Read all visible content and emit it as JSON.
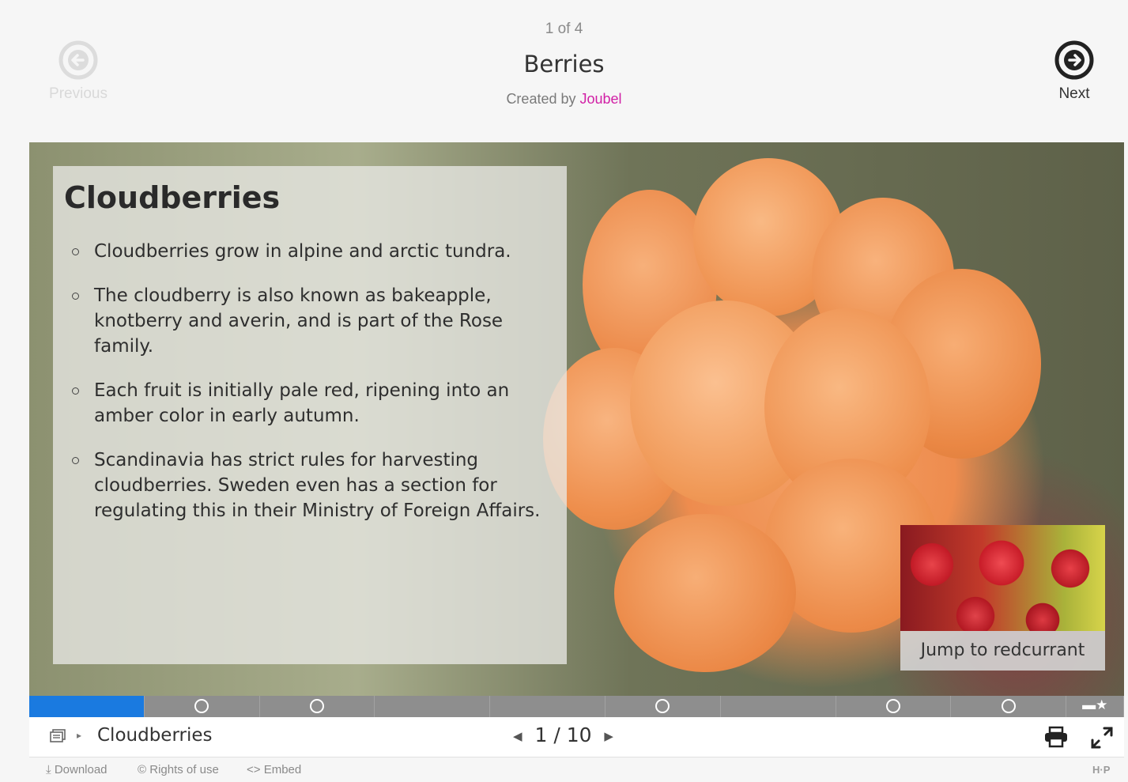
{
  "header": {
    "counter": "1 of 4",
    "title": "Berries",
    "created_by_label": "Created by",
    "author": "Joubel",
    "previous_label": "Previous",
    "next_label": "Next",
    "author_color": "#d11fa5"
  },
  "slide": {
    "heading": "Cloudberries",
    "bullets": [
      "Cloudberries grow in alpine and arctic tundra.",
      "The cloudberry is also known as bakeapple, knotberry and averin, and is part of the Rose family.",
      "Each fruit is initially pale red, ripening into an amber color in early autumn.",
      "Scandinavia has strict rules for harvesting cloudberries. Sweden even has a section for regulating this in their Ministry of Foreign Affairs."
    ],
    "jump_label": "Jump to redcurrant"
  },
  "progress": {
    "current": 1,
    "total": 10,
    "accent": "#1a7ae0",
    "slides_with_tasks": [
      2,
      3,
      6,
      8,
      9
    ]
  },
  "footer": {
    "breadcrumb": "Cloudberries",
    "page_current": "1",
    "page_separator": "/",
    "page_total": "10"
  },
  "bottom_links": {
    "download": "Download",
    "rights": "Rights of use",
    "embed": "Embed",
    "logo": "H·P"
  }
}
